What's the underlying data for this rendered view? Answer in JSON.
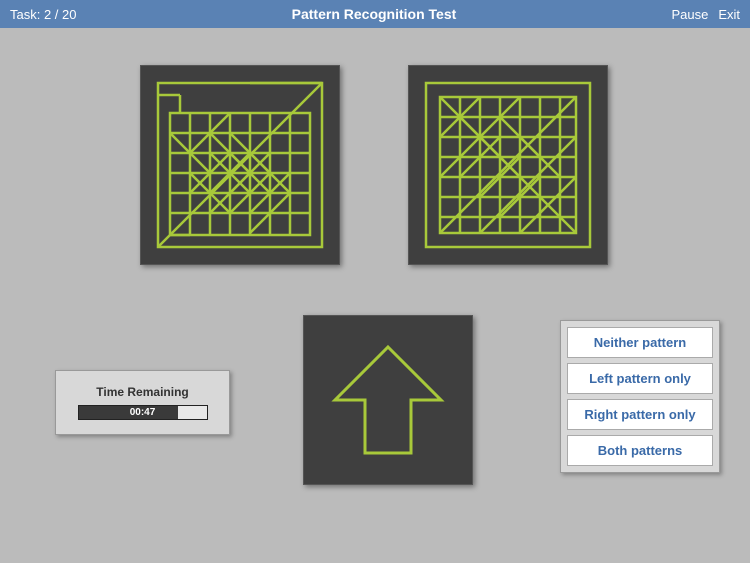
{
  "header": {
    "task_label": "Task: 2 / 20",
    "title": "Pattern Recognition Test",
    "pause": "Pause",
    "exit": "Exit"
  },
  "timer": {
    "label": "Time Remaining",
    "value": "00:47",
    "progress_percent": 78
  },
  "answers": {
    "neither": "Neither pattern",
    "left": "Left pattern only",
    "right": "Right pattern only",
    "both": "Both patterns"
  },
  "colors": {
    "header_bg": "#5a82b4",
    "box_bg": "#3f3f3f",
    "pattern_stroke": "#a8c93a",
    "answer_text": "#3a6aa8"
  }
}
